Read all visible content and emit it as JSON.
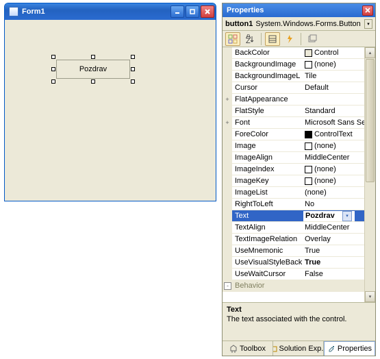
{
  "form": {
    "title": "Form1",
    "button_text": "Pozdrav"
  },
  "props_panel": {
    "title": "Properties",
    "object_name": "button1",
    "object_type": "System.Windows.Forms.Button"
  },
  "properties": [
    {
      "name": "BackColor",
      "value": "Control",
      "swatch": "#ece9d8"
    },
    {
      "name": "BackgroundImage",
      "value": "(none)",
      "swatch": "#ffffff"
    },
    {
      "name": "BackgroundImageL",
      "value": "Tile"
    },
    {
      "name": "Cursor",
      "value": "Default"
    },
    {
      "name": "FlatAppearance",
      "value": "",
      "expander": "+"
    },
    {
      "name": "FlatStyle",
      "value": "Standard"
    },
    {
      "name": "Font",
      "value": "Microsoft Sans Serif;",
      "expander": "+"
    },
    {
      "name": "ForeColor",
      "value": "ControlText",
      "swatch": "#000000"
    },
    {
      "name": "Image",
      "value": "(none)",
      "swatch": "#ffffff"
    },
    {
      "name": "ImageAlign",
      "value": "MiddleCenter"
    },
    {
      "name": "ImageIndex",
      "value": "(none)",
      "swatch": "#ffffff"
    },
    {
      "name": "ImageKey",
      "value": "(none)",
      "swatch": "#ffffff"
    },
    {
      "name": "ImageList",
      "value": "(none)"
    },
    {
      "name": "RightToLeft",
      "value": "No"
    },
    {
      "name": "Text",
      "value": "Pozdrav",
      "selected": true
    },
    {
      "name": "TextAlign",
      "value": "MiddleCenter"
    },
    {
      "name": "TextImageRelation",
      "value": "Overlay"
    },
    {
      "name": "UseMnemonic",
      "value": "True"
    },
    {
      "name": "UseVisualStyleBack",
      "value": "True",
      "bold": true
    },
    {
      "name": "UseWaitCursor",
      "value": "False"
    }
  ],
  "category": {
    "expander": "-",
    "name": "Behavior"
  },
  "description": {
    "title": "Text",
    "text": "The text associated with the control."
  },
  "tabs": {
    "toolbox": "Toolbox",
    "solution": "Solution Exp...",
    "properties": "Properties"
  }
}
